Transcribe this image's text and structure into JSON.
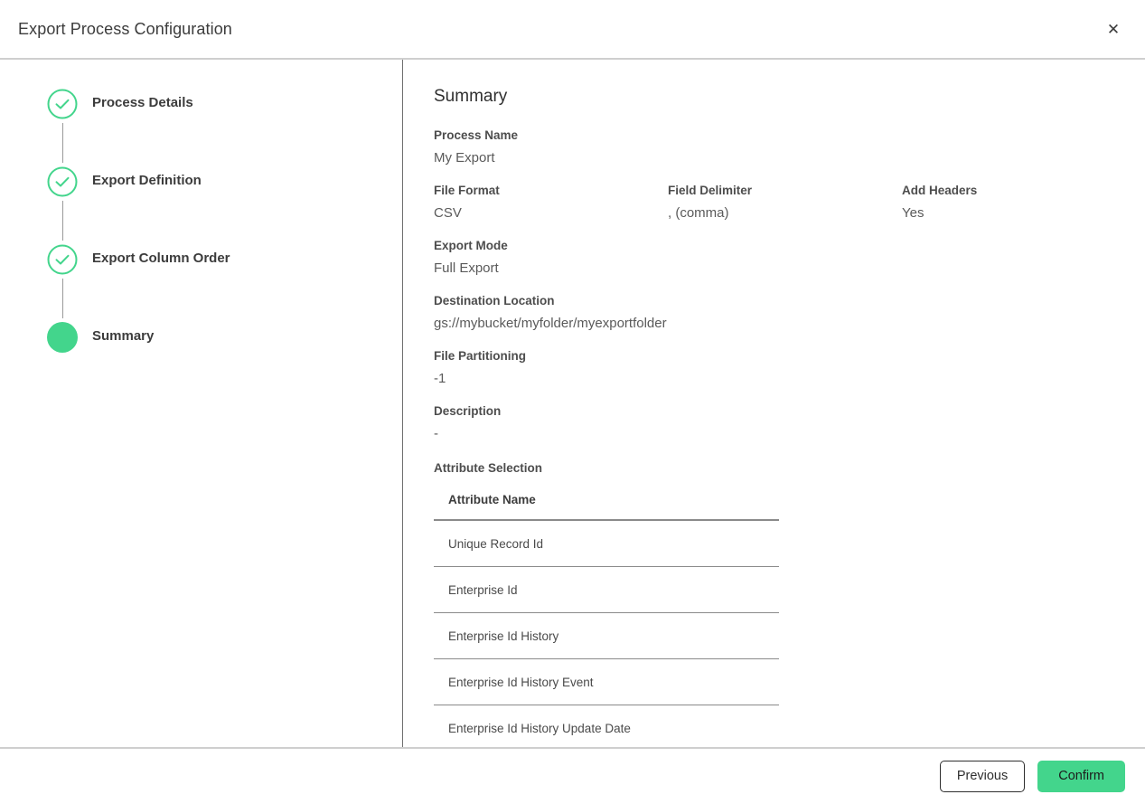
{
  "header": {
    "title": "Export Process Configuration",
    "close_icon": "close-icon",
    "close_glyph": "✕"
  },
  "stepper": {
    "steps": [
      {
        "label": "Process Details",
        "state": "complete",
        "icon": "check-circle-icon"
      },
      {
        "label": "Export Definition",
        "state": "complete",
        "icon": "check-circle-icon"
      },
      {
        "label": "Export Column Order",
        "state": "complete",
        "icon": "check-circle-icon"
      },
      {
        "label": "Summary",
        "state": "current",
        "icon": "filled-dot-icon"
      }
    ]
  },
  "summary": {
    "heading": "Summary",
    "fields": {
      "process_name_label": "Process Name",
      "process_name_value": "My Export",
      "file_format_label": "File Format",
      "file_format_value": "CSV",
      "field_delimiter_label": "Field Delimiter",
      "field_delimiter_value": ", (comma)",
      "add_headers_label": "Add Headers",
      "add_headers_value": "Yes",
      "export_mode_label": "Export Mode",
      "export_mode_value": "Full Export",
      "destination_location_label": "Destination Location",
      "destination_location_value": "gs://mybucket/myfolder/myexportfolder",
      "file_partitioning_label": "File Partitioning",
      "file_partitioning_value": "-1",
      "description_label": "Description",
      "description_value": "-"
    },
    "attribute_selection": {
      "section_label": "Attribute Selection",
      "column_header": "Attribute Name",
      "rows": [
        "Unique Record Id",
        "Enterprise Id",
        "Enterprise Id History",
        "Enterprise Id History Event",
        "Enterprise Id History Update Date"
      ]
    }
  },
  "footer": {
    "previous_label": "Previous",
    "confirm_label": "Confirm"
  },
  "colors": {
    "accent_green": "#43d58c",
    "text_dark": "#3c3c3c",
    "text_value": "#5a5a5a",
    "border_gray": "#cfcfcf",
    "divider_gray": "#8a8a8a"
  }
}
